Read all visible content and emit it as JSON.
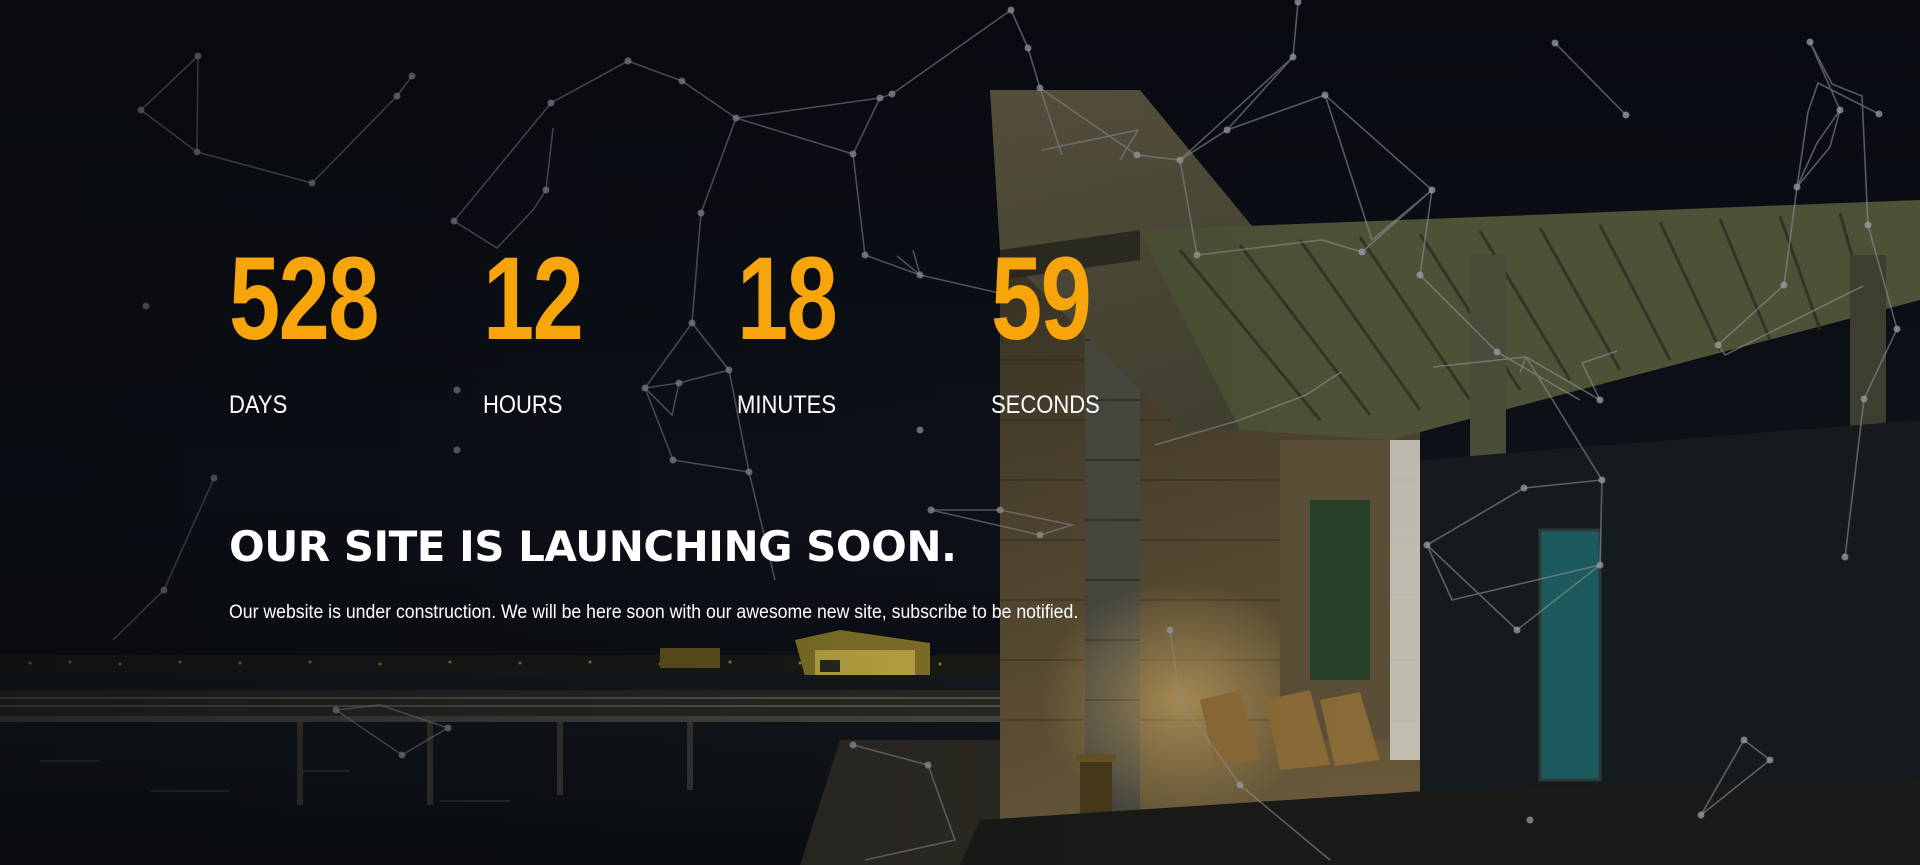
{
  "countdown": {
    "days": {
      "value": "528",
      "label": "DAYS"
    },
    "hours": {
      "value": "12",
      "label": "HOURS"
    },
    "minutes": {
      "value": "18",
      "label": "MINUTES"
    },
    "seconds": {
      "value": "59",
      "label": "SECONDS"
    }
  },
  "headline": "OUR SITE IS LAUNCHING SOON.",
  "subtext": "Our website is under construction. We will be here soon with our awesome new site, subscribe to be notified.",
  "colors": {
    "accent": "#f7a50a",
    "text": "#ffffff",
    "background": "#07090d",
    "network_lines": "#8a8f96"
  }
}
